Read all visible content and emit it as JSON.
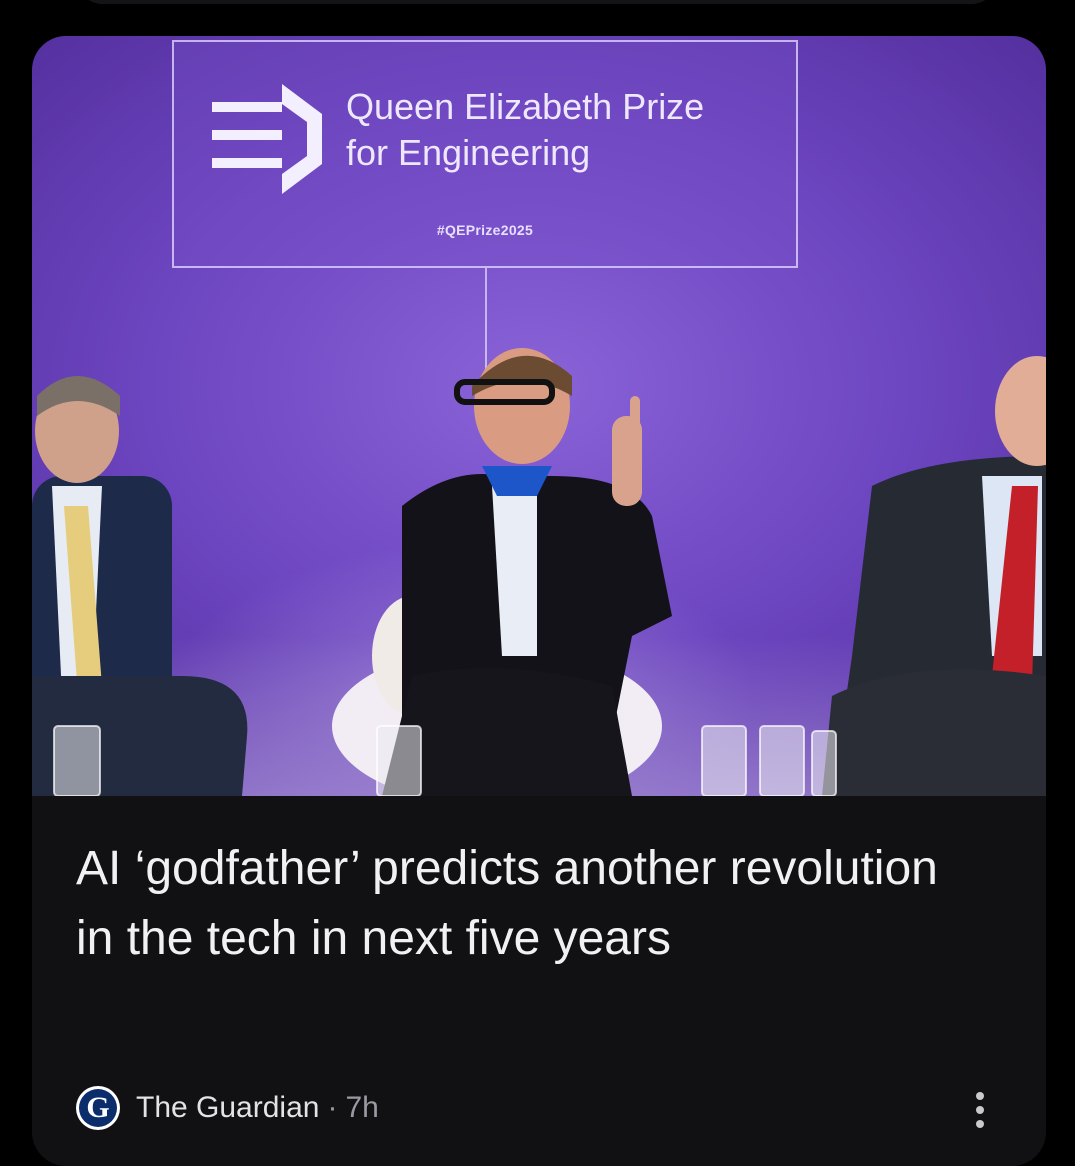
{
  "article": {
    "image": {
      "banner": {
        "title_line1": "Queen Elizabeth Prize",
        "title_line2": "for Engineering",
        "hashtag": "#QEPrize2025"
      },
      "icon": "photo-of-three-panelists-on-stage"
    },
    "headline": "AI ‘godfather’ predicts another revolution in the tech in next five years",
    "source": {
      "name": "The Guardian",
      "logo_letter": "G",
      "logo_icon": "guardian-logo-icon",
      "separator": "·",
      "age": "7h"
    },
    "more_icon": "more-vert-icon"
  },
  "colors": {
    "background": "#000000",
    "card": "#111114",
    "headline_text": "#f1f1f3",
    "meta_text": "#9a9aa2",
    "stage_purple": "#6c45c0"
  }
}
